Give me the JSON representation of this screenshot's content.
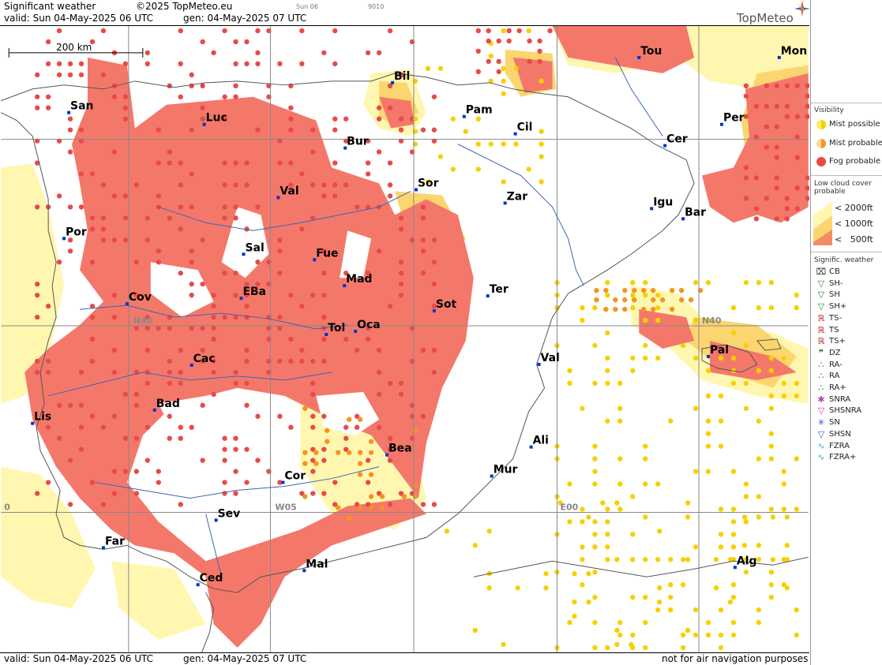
{
  "header": {
    "title": "Significant weather",
    "copyright": "©2025 TopMeteo.eu",
    "step": "Sun 06",
    "code": "9010",
    "valid": "valid:  Sun  04-May-2025  06 UTC",
    "gen": "gen:  04-May-2025  07 UTC",
    "brand": "TopMeteo"
  },
  "footer": {
    "valid": "valid:  Sun  04-May-2025  06 UTC",
    "gen": "gen:  04-May-2025  07 UTC",
    "disclaimer": "not for air navigation purposes"
  },
  "map": {
    "scale": "200 km",
    "grid_labels": [
      "N40",
      "N40",
      "W05",
      "E00",
      "0"
    ],
    "cities": [
      "San",
      "Luc",
      "Bil",
      "Pam",
      "Cil",
      "Bur",
      "Sor",
      "Zar",
      "Val",
      "Por",
      "Sal",
      "Fue",
      "Mad",
      "Cov",
      "EBa",
      "Tol",
      "Oca",
      "Sot",
      "Ter",
      "Cac",
      "Val",
      "Pal",
      "Bad",
      "Lis",
      "Bea",
      "Ali",
      "Cor",
      "Mur",
      "Sev",
      "Far",
      "Mal",
      "Alg",
      "Ced",
      "Tou",
      "Mon",
      "Per",
      "Cer",
      "Igu",
      "Bar"
    ]
  },
  "legend": {
    "visibility": {
      "title": "Visibility",
      "items": [
        "Mist possible",
        "Mist probable",
        "Fog probable"
      ]
    },
    "lowcloud": {
      "title": "Low cloud cover probable",
      "items": [
        "< 2000ft",
        "< 1000ft",
        "<   500ft"
      ]
    },
    "sigwx": {
      "title": "Signific. weather",
      "items": [
        "CB",
        "SH-",
        "SH",
        "SH+",
        "TS-",
        "TS",
        "TS+",
        "DZ",
        "RA-",
        "RA",
        "RA+",
        "SNRA",
        "SHSNRA",
        "SN",
        "SHSN",
        "FZRA",
        "FZRA+"
      ]
    }
  },
  "colors": {
    "fog": "#e84a4a",
    "mist": "#f7931e",
    "lc2000": "#fff7b0",
    "lc1000": "#fbd670",
    "lc500": "#f28b66",
    "patch": "#f4786a",
    "grid": "#888888",
    "coast": "#555555",
    "river": "#3a66b0",
    "city": "#0033cc"
  }
}
